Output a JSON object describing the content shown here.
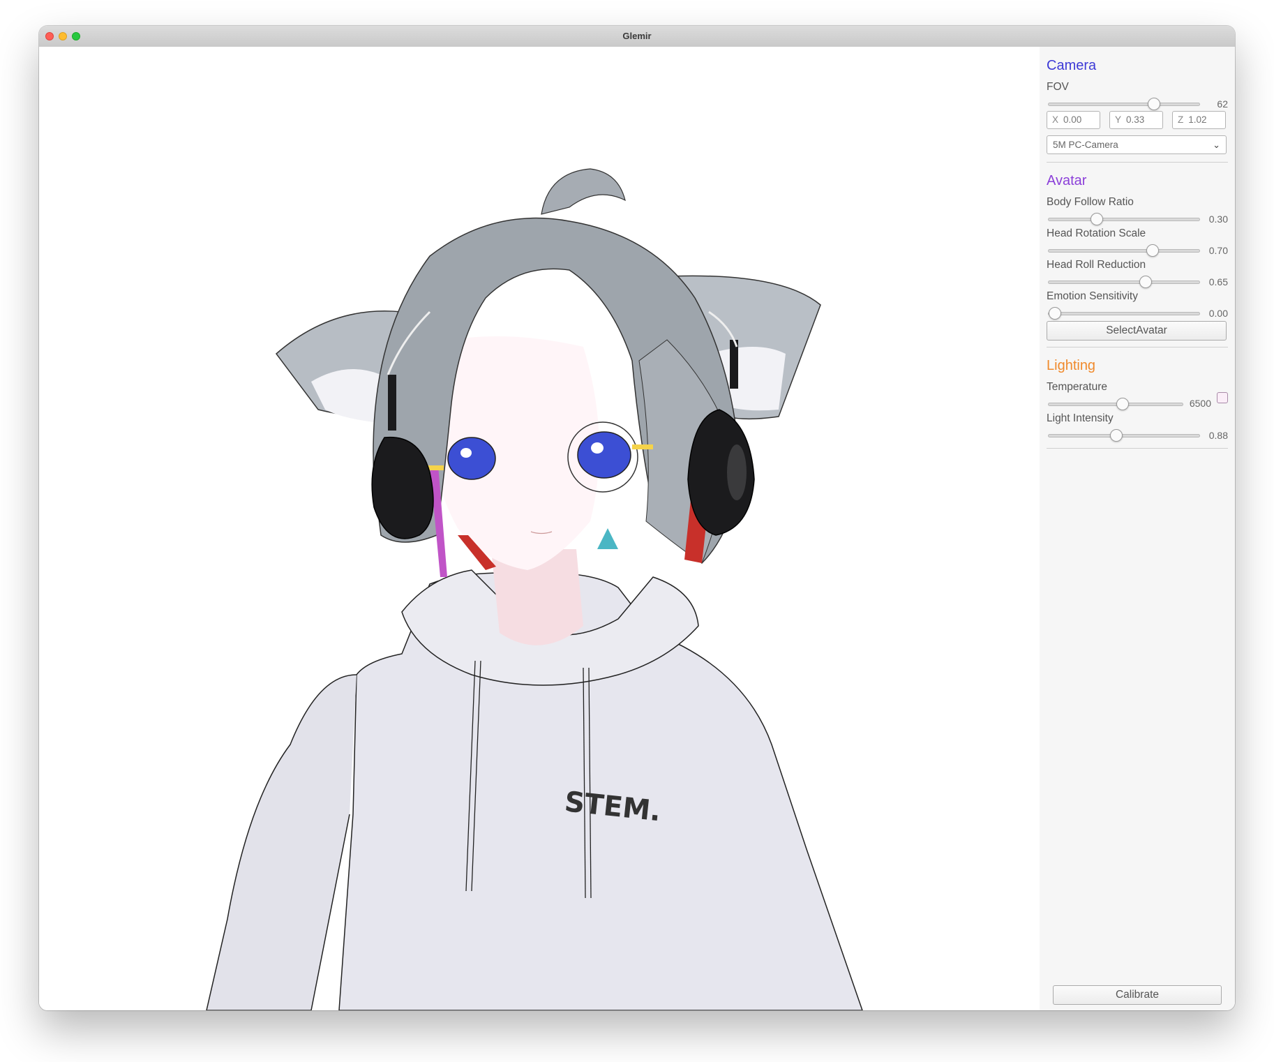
{
  "window": {
    "title": "Glemir"
  },
  "colors": {
    "camera_heading": "#3d3ad6",
    "avatar_heading": "#8b3fd9",
    "lighting_heading": "#f08a2c",
    "temperature_swatch": "#fbeef8"
  },
  "viewport": {
    "description_icon": "avatar-render"
  },
  "camera": {
    "heading": "Camera",
    "fov": {
      "label": "FOV",
      "value": "62",
      "fraction": 0.71
    },
    "position": {
      "x_label": "X",
      "x": "0.00",
      "y_label": "Y",
      "y": "0.33",
      "z_label": "Z",
      "z": "1.02"
    },
    "device": {
      "selected": "5M PC-Camera"
    }
  },
  "avatar": {
    "heading": "Avatar",
    "sliders": [
      {
        "label": "Body Follow Ratio",
        "value": "0.30",
        "fraction": 0.3
      },
      {
        "label": "Head Rotation Scale",
        "value": "0.70",
        "fraction": 0.7
      },
      {
        "label": "Head Roll Reduction",
        "value": "0.65",
        "fraction": 0.65
      },
      {
        "label": "Emotion Sensitivity",
        "value": "0.00",
        "fraction": 0.0
      }
    ],
    "select_button": "SelectAvatar"
  },
  "lighting": {
    "heading": "Lighting",
    "temperature": {
      "label": "Temperature",
      "value": "6500",
      "fraction": 0.55
    },
    "intensity": {
      "label": "Light Intensity",
      "value": "0.88",
      "fraction": 0.44
    }
  },
  "calibrate_button": "Calibrate"
}
